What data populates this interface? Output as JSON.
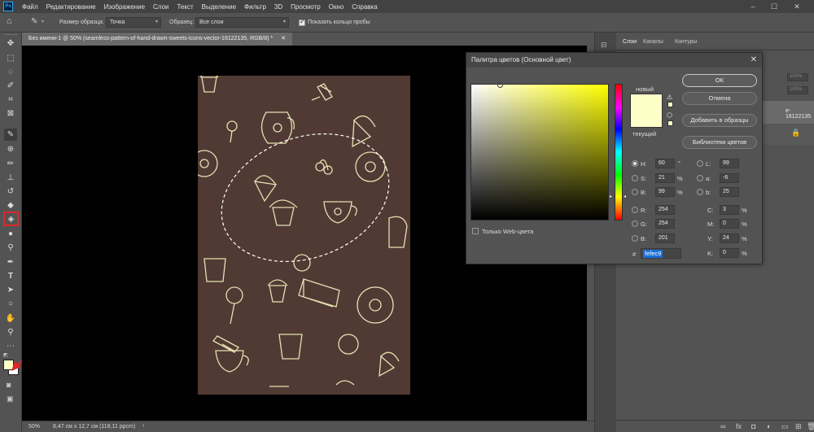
{
  "app": {
    "logo_text": "Ps",
    "menu": [
      "Файл",
      "Редактирование",
      "Изображение",
      "Слои",
      "Текст",
      "Выделение",
      "Фильтр",
      "3D",
      "Просмотр",
      "Окно",
      "Справка"
    ],
    "window_controls": {
      "minimize": "–",
      "maximize": "☐",
      "close": "✕"
    }
  },
  "options_bar": {
    "sample_size_label": "Размер образца:",
    "sample_size_value": "Точка",
    "sample_label": "Образец:",
    "sample_value": "Все слои",
    "show_ring_label": "Показать кольцо пробы",
    "show_ring_checked": true
  },
  "document": {
    "tab_title": "Без имени-1 @ 50% (seamless-pattern-of-hand-drawn-sweets-icons-vector-16122135, RGB/8) *",
    "tab_close": "✕",
    "canvas_bg": "#000000",
    "artwork_bg": "#513a34",
    "artwork_line_color": "#fefec9"
  },
  "status_bar": {
    "zoom": "50%",
    "doc_size": "8,47 см x 12,7 см (118,11 ppcm)",
    "arrow": "›"
  },
  "layers_panel": {
    "tabs": [
      "Слои",
      "Каналы",
      "Контуры"
    ],
    "opacity_value": "100%",
    "fill_value": "100%",
    "layer_name_fragment": "e-16122135"
  },
  "color_picker": {
    "title": "Палитра цветов (Основной цвет)",
    "close": "✕",
    "new_label": "новый",
    "current_label": "текущий",
    "new_color": "#fefec9",
    "current_color": "#fefec9",
    "hue_color": "#ffff00",
    "buttons": {
      "ok": "OK",
      "cancel": "Отмена",
      "add_to_swatches": "Добавить в образцы",
      "color_libraries": "Библиотеки цветов"
    },
    "only_web_colors_label": "Только Web-цвета",
    "hsb": {
      "H": "60",
      "S": "21",
      "B": "99",
      "H_unit": "°",
      "S_unit": "%",
      "B_unit": "%"
    },
    "rgb": {
      "R": "254",
      "G": "254",
      "B": "201"
    },
    "lab": {
      "L": "99",
      "a": "-6",
      "b": "25"
    },
    "cmyk": {
      "C": "3",
      "M": "0",
      "Y": "24",
      "K": "0",
      "unit": "%"
    },
    "hex_label": "#",
    "hex_value": "fefec9",
    "field_labels": {
      "H": "H:",
      "S": "S:",
      "B": "B:",
      "R": "R:",
      "G": "G:",
      "B2": "B:",
      "L": "L:",
      "a": "a:",
      "b": "b:",
      "C": "C:",
      "M": "M:",
      "Y": "Y:",
      "K": "K:"
    }
  },
  "tools": [
    "move-tool-icon",
    "marquee-tool-icon",
    "lasso-tool-icon",
    "quick-select-icon",
    "crop-tool-icon",
    "frame-tool-icon",
    "eyedropper-tool-icon",
    "spot-heal-icon",
    "brush-tool-icon",
    "clone-stamp-icon",
    "history-brush-icon",
    "eraser-tool-icon",
    "paint-bucket-icon",
    "blur-tool-icon",
    "dodge-tool-icon",
    "pen-tool-icon",
    "type-tool-icon",
    "path-select-icon",
    "shape-tool-icon",
    "hand-tool-icon",
    "zoom-tool-icon",
    "more-tools-icon"
  ],
  "highlight_color": "#e0262a",
  "foreground_color": "#fefec9",
  "background_color": "#ffffff"
}
